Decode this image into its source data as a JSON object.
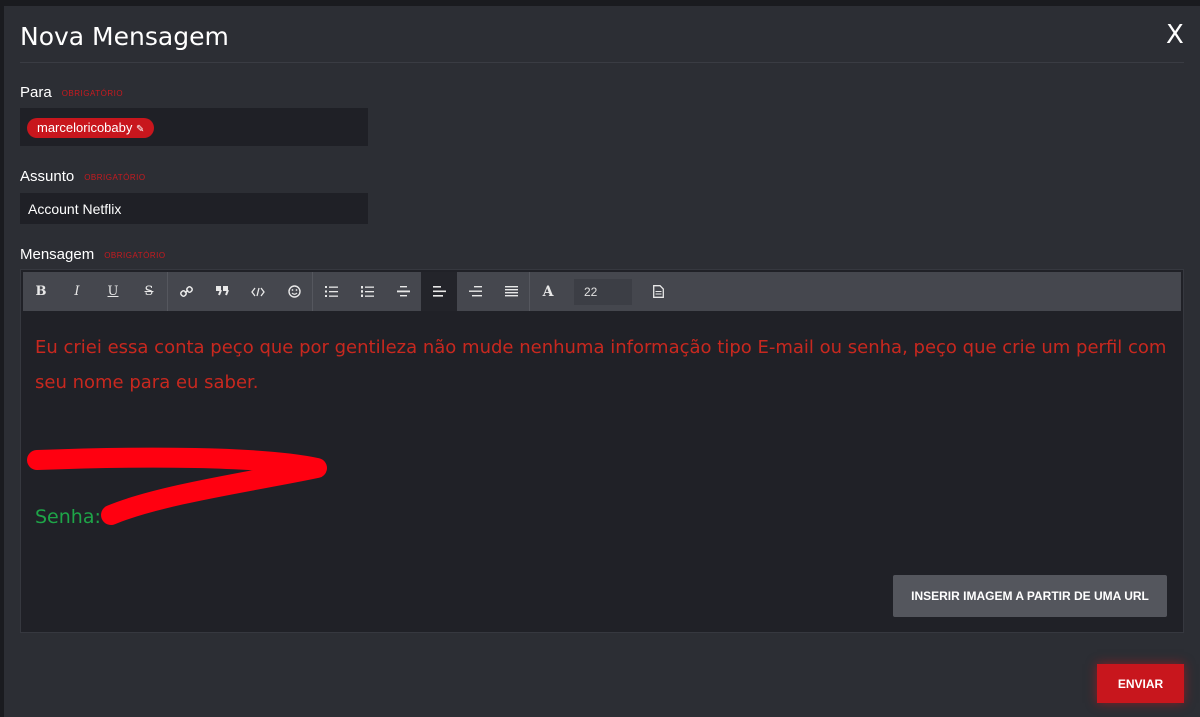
{
  "dialog": {
    "title": "Nova Mensagem",
    "close_label": "X"
  },
  "to": {
    "label": "Para",
    "required": "obrigatório",
    "recipient": "marceloricobaby",
    "edit_glyph": "✎"
  },
  "subject": {
    "label": "Assunto",
    "required": "obrigatório",
    "value": "Account Netflix"
  },
  "message": {
    "label": "Mensagem",
    "required": "obrigatório",
    "font_size": "22",
    "body": "Eu criei essa conta peço que por gentileza não mude nenhuma informação tipo E-mail ou senha, peço que crie um perfil com seu nome para eu saber.",
    "password_label": "Senha:",
    "text_color": "#c8281f",
    "password_color": "#1ea548"
  },
  "toolbar": {
    "bold": "B",
    "italic": "I",
    "underline": "U",
    "strike": "S",
    "font_color": "A"
  },
  "buttons": {
    "insert_image": "INSERIR IMAGEM A PARTIR DE UMA URL",
    "send": "ENVIAR"
  },
  "colors": {
    "accent": "#c8161d",
    "background": "#2c2e34"
  }
}
